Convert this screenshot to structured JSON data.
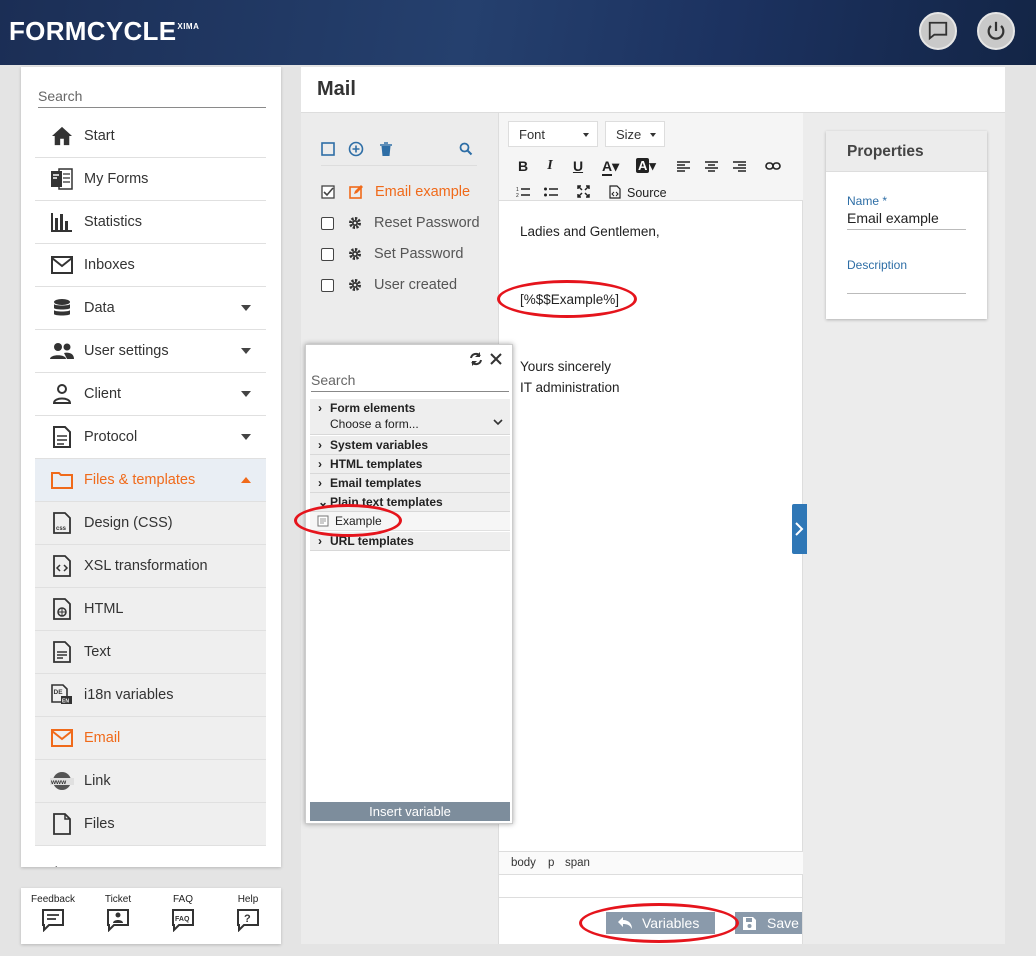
{
  "app": {
    "brand": "FORMCYCLE",
    "brand_sup": "XIMA"
  },
  "sidebar": {
    "search_placeholder": "Search",
    "items": [
      {
        "label": "Start",
        "icon": "home-icon"
      },
      {
        "label": "My Forms",
        "icon": "forms-icon"
      },
      {
        "label": "Statistics",
        "icon": "bar-chart-icon"
      },
      {
        "label": "Inboxes",
        "icon": "envelope-icon"
      },
      {
        "label": "Data",
        "icon": "database-icon"
      },
      {
        "label": "User settings",
        "icon": "users-icon"
      },
      {
        "label": "Client",
        "icon": "person-icon"
      },
      {
        "label": "Protocol",
        "icon": "document-icon"
      },
      {
        "label": "Files & templates",
        "icon": "folder-icon"
      }
    ],
    "sub_items": [
      {
        "label": "Design (CSS)",
        "icon": "css-file-icon"
      },
      {
        "label": "XSL transformation",
        "icon": "xsl-file-icon"
      },
      {
        "label": "HTML",
        "icon": "html-file-icon"
      },
      {
        "label": "Text",
        "icon": "text-file-icon"
      },
      {
        "label": "i18n variables",
        "icon": "i18n-icon"
      },
      {
        "label": "Email",
        "icon": "email-icon"
      },
      {
        "label": "Link",
        "icon": "www-link-icon"
      },
      {
        "label": "Files",
        "icon": "file-icon"
      }
    ]
  },
  "helpbar": {
    "feedback": "Feedback",
    "ticket": "Ticket",
    "faq": "FAQ",
    "help": "Help"
  },
  "main": {
    "title": "Mail"
  },
  "templates": {
    "items": [
      {
        "label": "Email example",
        "checked": true,
        "active": true
      },
      {
        "label": "Reset Password",
        "checked": false
      },
      {
        "label": "Set Password",
        "checked": false
      },
      {
        "label": "User created",
        "checked": false
      }
    ]
  },
  "editor": {
    "font_label": "Font",
    "size_label": "Size",
    "source_label": "Source",
    "line1": "Ladies and Gentlemen,",
    "placeholder_var": "[%$$Example%]",
    "line2": "Yours sincerely",
    "line3": "IT administration",
    "path": {
      "p1": "body",
      "p2": "p",
      "p3": "span"
    },
    "variables_button": "Variables",
    "save_button": "Save"
  },
  "properties": {
    "title": "Properties",
    "name_label": "Name *",
    "name_value": "Email example",
    "description_label": "Description"
  },
  "popup": {
    "search_placeholder": "Search",
    "form_elements": "Form elements",
    "choose_form": "Choose a form...",
    "system_variables": "System variables",
    "html_templates": "HTML templates",
    "email_templates": "Email templates",
    "plain_text_templates": "Plain text templates",
    "example": "Example",
    "url_templates": "URL templates",
    "insert_variable": "Insert variable"
  },
  "colors": {
    "accent_orange": "#f06a1a",
    "link_blue": "#2e6ea6",
    "highlight_red": "#e5141c",
    "header_navy": "#1b2e55"
  }
}
